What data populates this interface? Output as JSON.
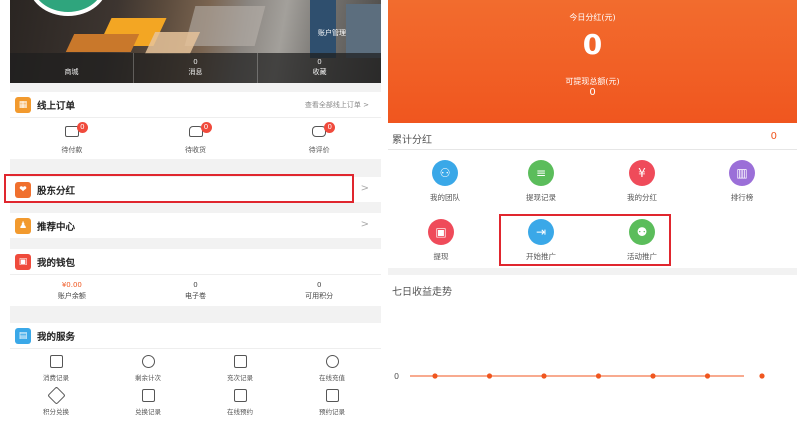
{
  "left": {
    "header": {
      "account_label": "账户管理",
      "stats": [
        {
          "label": "商城",
          "value": ""
        },
        {
          "label": "消息",
          "value": "0"
        },
        {
          "label": "收藏",
          "value": "0"
        }
      ]
    },
    "orders": {
      "title": "线上订单",
      "view_all": "查看全部线上订单 >",
      "items": [
        {
          "label": "待付款",
          "badge": "0",
          "icon": "wallet-card-icon"
        },
        {
          "label": "待收货",
          "badge": "0",
          "icon": "truck-icon"
        },
        {
          "label": "待评价",
          "badge": "0",
          "icon": "comment-icon"
        }
      ]
    },
    "shareholder": {
      "title": "股东分红",
      "arrow": ">"
    },
    "recommend": {
      "title": "推荐中心",
      "arrow": ">"
    },
    "wallet": {
      "title": "我的钱包",
      "items": [
        {
          "value": "¥0.00",
          "label": "账户余额",
          "color": "#f0561f"
        },
        {
          "value": "0",
          "label": "电子卷",
          "color": "#444444"
        },
        {
          "value": "0",
          "label": "可用积分",
          "color": "#444444"
        }
      ]
    },
    "services": {
      "title": "我的服务",
      "items": [
        {
          "label": "消费记录",
          "icon": "receipt-icon"
        },
        {
          "label": "剩余计次",
          "icon": "clock-icon"
        },
        {
          "label": "充次记录",
          "icon": "card-icon"
        },
        {
          "label": "在线充值",
          "icon": "yen-icon"
        },
        {
          "label": "积分兑换",
          "icon": "tag-icon"
        },
        {
          "label": "兑换记录",
          "icon": "exchange-icon"
        },
        {
          "label": "在线预约",
          "icon": "chart-icon"
        },
        {
          "label": "预约记录",
          "icon": "list-icon"
        }
      ]
    }
  },
  "right": {
    "today_label": "今日分红(元)",
    "today_value": "0",
    "withdrawable_label": "可提现总额(元)",
    "withdrawable_value": "0",
    "accum_label": "累计分红",
    "accum_value": "0",
    "grid": [
      {
        "label": "我的团队",
        "color": "#3aa8e8",
        "glyph": "⚇",
        "icon": "team-icon"
      },
      {
        "label": "提现记录",
        "color": "#5bbd5b",
        "glyph": "≡",
        "icon": "record-icon"
      },
      {
        "label": "我的分红",
        "color": "#ef4b5a",
        "glyph": "¥",
        "icon": "yen-icon"
      },
      {
        "label": "排行榜",
        "color": "#9b6fd8",
        "glyph": "▥",
        "icon": "ranking-icon"
      },
      {
        "label": "提现",
        "color": "#ef4b5a",
        "glyph": "▣",
        "icon": "wallet-icon"
      },
      {
        "label": "开始推广",
        "color": "#3aa8e8",
        "glyph": "⇥",
        "icon": "share-icon"
      },
      {
        "label": "活动推广",
        "color": "#5bbd5b",
        "glyph": "⚉",
        "icon": "group-icon"
      }
    ],
    "trend_title": "七日收益走势",
    "chart_data": {
      "type": "line",
      "x": [
        "",
        "",
        "",
        "",
        "",
        "",
        ""
      ],
      "series": [
        {
          "values": [
            0,
            0,
            0,
            0,
            0,
            0,
            0
          ]
        }
      ],
      "ytick": "0",
      "color": "#f0561f"
    }
  }
}
